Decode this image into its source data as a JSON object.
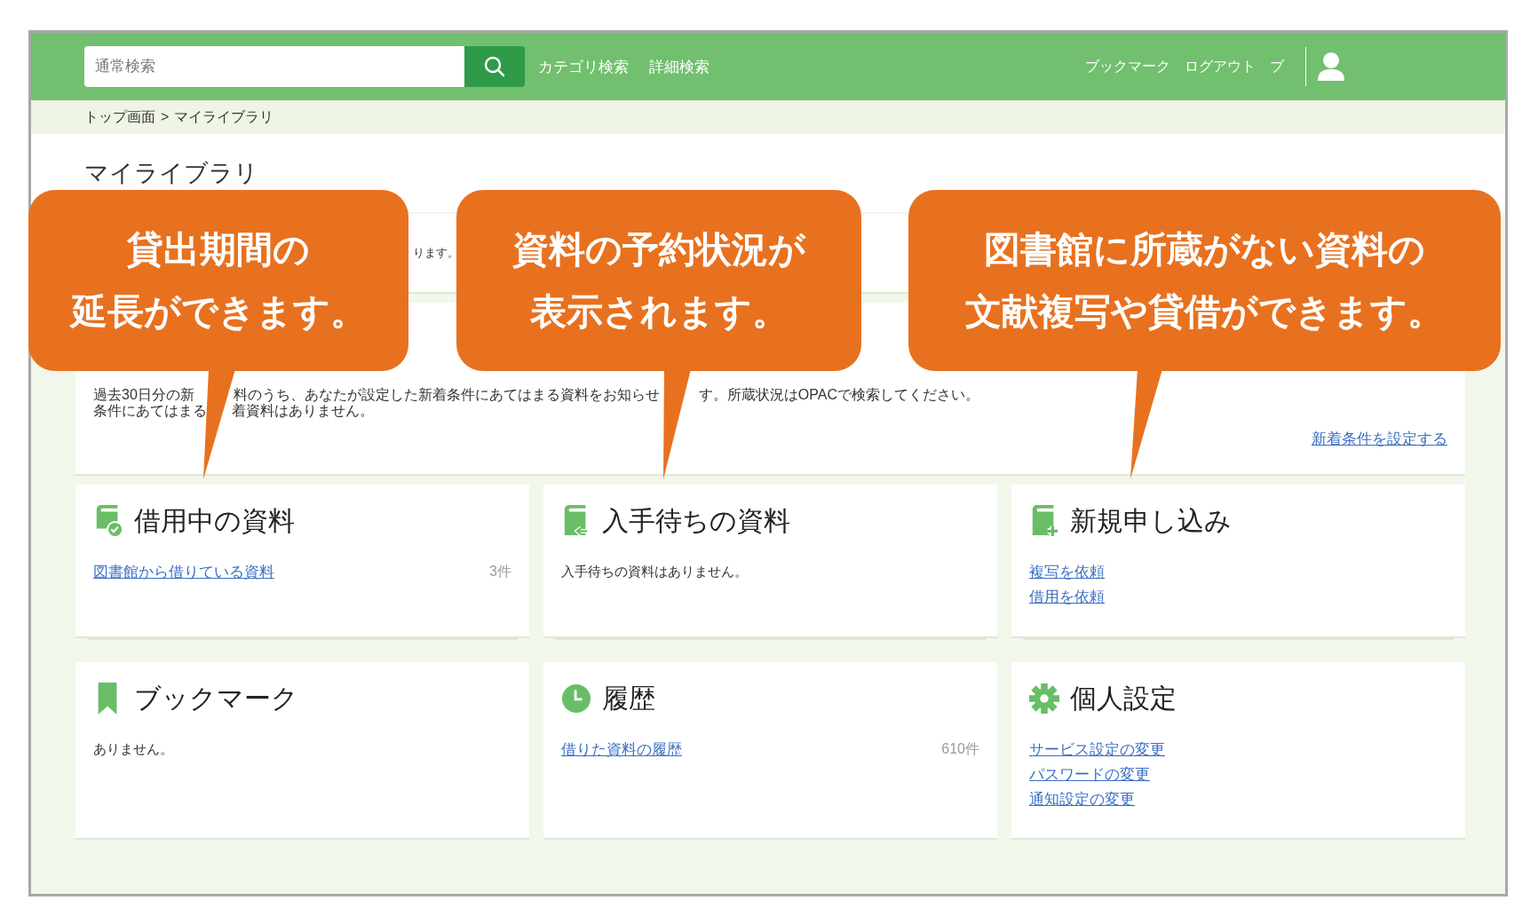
{
  "header": {
    "search": {
      "placeholder": "通常検索"
    },
    "nav_links": [
      "カテゴリ検索",
      "詳細検索"
    ],
    "user_links": [
      "ブックマーク",
      "ログアウト",
      "ブ"
    ]
  },
  "breadcrumb": {
    "items": [
      "トップ画面",
      "マイライブラリ"
    ],
    "separator": ">"
  },
  "page_title": "マイライブラリ",
  "notice": {
    "text": "ります。"
  },
  "new_arrivals": {
    "lines": [
      [
        "過去30日分の新",
        "料のうち、あなたが設定した新着条件にあてはまる資料をお知らせ",
        "す。所蔵状況はOPACで検索してください。"
      ],
      [
        "条件にあてはまる",
        "着資料はありません。"
      ]
    ],
    "link": "新着条件を設定する"
  },
  "cards": [
    {
      "title": "借用中の資料",
      "rows": [
        {
          "kind": "link",
          "text": "図書館から借りている資料",
          "count": "3件"
        }
      ]
    },
    {
      "title": "入手待ちの資料",
      "rows": [
        {
          "kind": "text",
          "text": "入手待ちの資料はありません。"
        }
      ]
    },
    {
      "title": "新規申し込み",
      "rows": [
        {
          "kind": "link",
          "text": "複写を依頼"
        },
        {
          "kind": "link",
          "text": "借用を依頼"
        }
      ]
    },
    {
      "title": "ブックマーク",
      "rows": [
        {
          "kind": "text",
          "text": "ありません。"
        }
      ]
    },
    {
      "title": "履歴",
      "rows": [
        {
          "kind": "link",
          "text": "借りた資料の履歴",
          "count": "610件"
        }
      ]
    },
    {
      "title": "個人設定",
      "rows": [
        {
          "kind": "link",
          "text": "サービス設定の変更"
        },
        {
          "kind": "link",
          "text": "パスワードの変更"
        },
        {
          "kind": "link",
          "text": "通知設定の変更"
        }
      ]
    }
  ],
  "callouts": [
    {
      "lines": [
        "貸出期間の",
        "延長ができます。"
      ]
    },
    {
      "lines": [
        "資料の予約状況が",
        "表示されます。"
      ]
    },
    {
      "lines": [
        "図書館に所蔵がない資料の",
        "文献複写や貸借ができます。"
      ]
    }
  ]
}
